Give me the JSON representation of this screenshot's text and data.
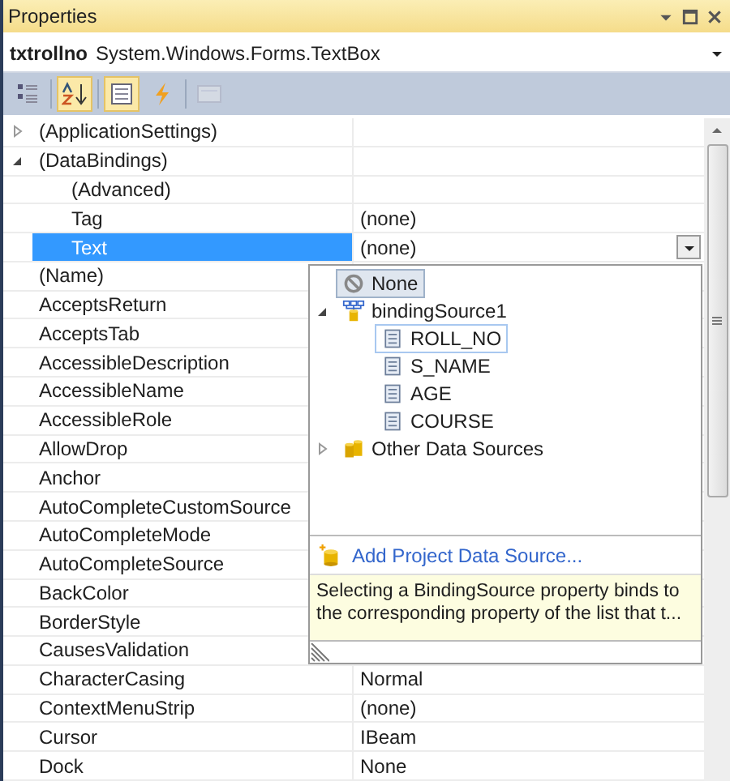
{
  "window": {
    "title": "Properties"
  },
  "object_selector": {
    "name": "txtrollno",
    "type": "System.Windows.Forms.TextBox"
  },
  "toolbar": [
    {
      "kind": "categorized",
      "selected": false,
      "disabled": false
    },
    {
      "kind": "alphabetical",
      "selected": true,
      "disabled": false
    },
    {
      "kind": "properties",
      "selected": true,
      "disabled": false
    },
    {
      "kind": "events",
      "selected": false,
      "disabled": false
    },
    {
      "kind": "pages",
      "selected": false,
      "disabled": true
    }
  ],
  "properties": [
    {
      "name": "(ApplicationSettings)",
      "expanded": false,
      "selected": false
    },
    {
      "name": "(DataBindings)",
      "expanded": true,
      "selected": false,
      "children": [
        {
          "name": "(Advanced)",
          "selected": false
        },
        {
          "name": "Tag",
          "value": "(none)",
          "selected": false
        },
        {
          "name": "Text",
          "value": "(none)",
          "selected": true
        }
      ]
    },
    {
      "name": "(Name)",
      "selected": false
    },
    {
      "name": "AcceptsReturn",
      "selected": false
    },
    {
      "name": "AcceptsTab",
      "selected": false
    },
    {
      "name": "AccessibleDescription",
      "selected": false
    },
    {
      "name": "AccessibleName",
      "selected": false
    },
    {
      "name": "AccessibleRole",
      "selected": false
    },
    {
      "name": "AllowDrop",
      "selected": false
    },
    {
      "name": "Anchor",
      "selected": false
    },
    {
      "name": "AutoCompleteCustomSource",
      "selected": false
    },
    {
      "name": "AutoCompleteMode",
      "selected": false
    },
    {
      "name": "AutoCompleteSource",
      "selected": false
    },
    {
      "name": "BackColor",
      "selected": false
    },
    {
      "name": "BorderStyle",
      "selected": false
    },
    {
      "name": "CausesValidation",
      "selected": false
    },
    {
      "name": "CharacterCasing",
      "value": "Normal",
      "selected": false
    },
    {
      "name": "ContextMenuStrip",
      "value": "(none)",
      "selected": false
    },
    {
      "name": "Cursor",
      "value": "IBeam",
      "selected": false
    },
    {
      "name": "Dock",
      "value": "None",
      "selected": false
    }
  ],
  "dropdown": {
    "items": [
      {
        "label": "None",
        "kind": "none",
        "selected": true,
        "hovered": false
      },
      {
        "label": "bindingSource1",
        "kind": "source",
        "expanded": true,
        "selected": false,
        "hovered": false,
        "children": [
          {
            "label": "ROLL_NO",
            "kind": "field",
            "selected": false,
            "hovered": true
          },
          {
            "label": "S_NAME",
            "kind": "field",
            "selected": false,
            "hovered": false
          },
          {
            "label": "AGE",
            "kind": "field",
            "selected": false,
            "hovered": false
          },
          {
            "label": "COURSE",
            "kind": "field",
            "selected": false,
            "hovered": false
          }
        ]
      },
      {
        "label": "Other Data Sources",
        "kind": "folder",
        "expanded": false,
        "selected": false,
        "hovered": false
      }
    ],
    "link": "Add Project Data Source...",
    "description": "Selecting a BindingSource property binds to the corresponding property of the list that t..."
  }
}
